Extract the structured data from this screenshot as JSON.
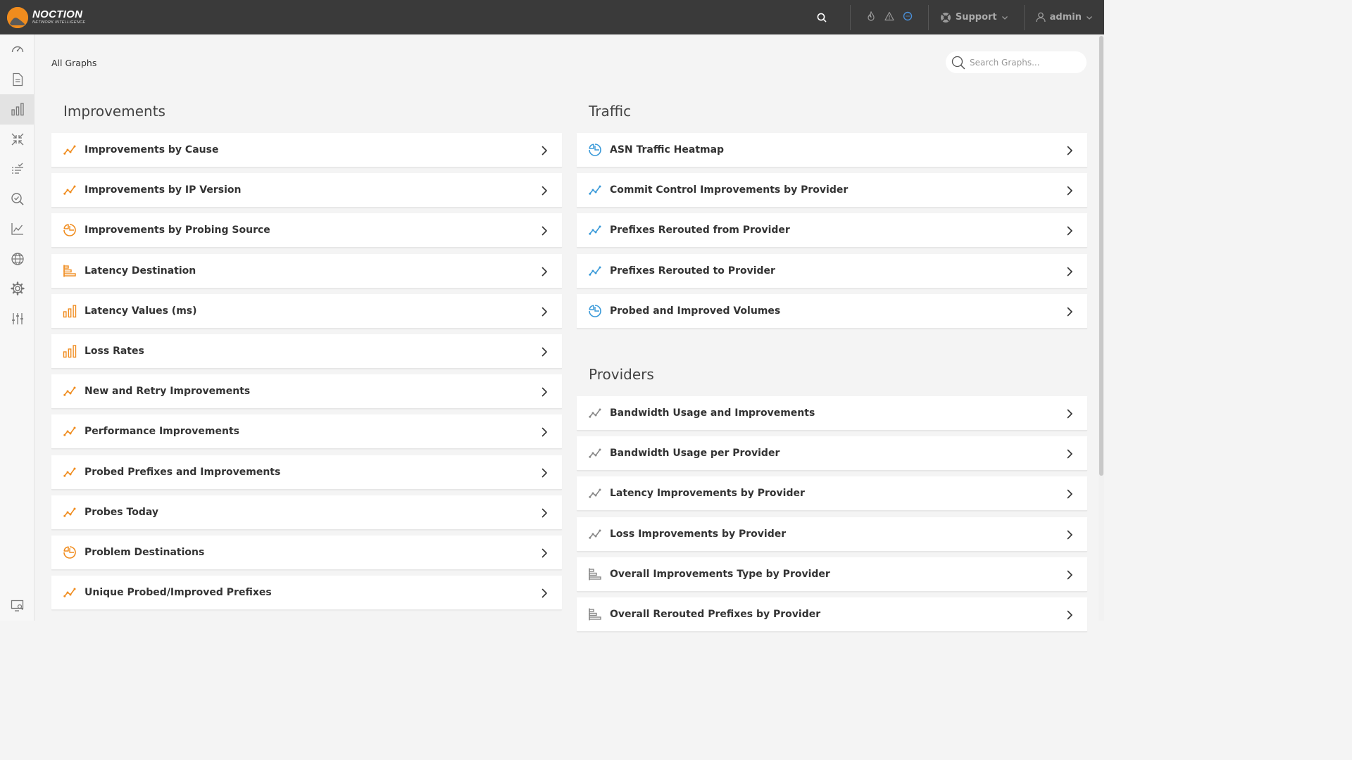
{
  "app": {
    "logo_name": "NOCTION",
    "logo_sub": "NETWORK INTELLIGENCE",
    "accent_color": "#f08c1e",
    "traffic_color": "#3a9ad9",
    "provider_color": "#888888"
  },
  "topbar": {
    "support_label": "Support",
    "user_label": "admin"
  },
  "sidebar": {
    "items": [
      {
        "icon": "speedometer-icon"
      },
      {
        "icon": "report-icon"
      },
      {
        "icon": "bar-chart-icon",
        "active": true
      },
      {
        "icon": "compress-arrows-icon"
      },
      {
        "icon": "checklist-icon"
      },
      {
        "icon": "search-check-icon"
      },
      {
        "icon": "line-graph-icon"
      },
      {
        "icon": "globe-icon"
      },
      {
        "icon": "gear-icon"
      },
      {
        "icon": "sliders-icon"
      }
    ],
    "bottom_icon": "monitor-search-icon"
  },
  "breadcrumb": "All Graphs",
  "search": {
    "placeholder": "Search Graphs..."
  },
  "sections": {
    "improvements": {
      "title": "Improvements",
      "items": [
        {
          "label": "Improvements by Cause",
          "icon": "line-icon"
        },
        {
          "label": "Improvements by IP Version",
          "icon": "line-icon"
        },
        {
          "label": "Improvements by Probing Source",
          "icon": "pie-icon"
        },
        {
          "label": "Latency Destination",
          "icon": "hbar-icon"
        },
        {
          "label": "Latency Values (ms)",
          "icon": "vbar-icon"
        },
        {
          "label": "Loss Rates",
          "icon": "vbar-icon"
        },
        {
          "label": "New and Retry Improvements",
          "icon": "line-icon"
        },
        {
          "label": "Performance Improvements",
          "icon": "line-icon"
        },
        {
          "label": "Probed Prefixes and Improvements",
          "icon": "line-icon"
        },
        {
          "label": "Probes Today",
          "icon": "line-icon"
        },
        {
          "label": "Problem Destinations",
          "icon": "pie-icon"
        },
        {
          "label": "Unique Probed/Improved Prefixes",
          "icon": "line-icon"
        }
      ]
    },
    "traffic": {
      "title": "Traffic",
      "items": [
        {
          "label": "ASN Traffic Heatmap",
          "icon": "pie-icon"
        },
        {
          "label": "Commit Control Improvements by Provider",
          "icon": "line-icon"
        },
        {
          "label": "Prefixes Rerouted from Provider",
          "icon": "line-icon"
        },
        {
          "label": "Prefixes Rerouted to Provider",
          "icon": "line-icon"
        },
        {
          "label": "Probed and Improved Volumes",
          "icon": "pie-icon"
        }
      ]
    },
    "providers": {
      "title": "Providers",
      "items": [
        {
          "label": "Bandwidth Usage and Improvements",
          "icon": "line-icon"
        },
        {
          "label": "Bandwidth Usage per Provider",
          "icon": "line-icon"
        },
        {
          "label": "Latency Improvements by Provider",
          "icon": "line-icon"
        },
        {
          "label": "Loss Improvements by Provider",
          "icon": "line-icon"
        },
        {
          "label": "Overall Improvements Type by Provider",
          "icon": "hbar-icon"
        },
        {
          "label": "Overall Rerouted Prefixes by Provider",
          "icon": "hbar-icon"
        }
      ]
    }
  }
}
